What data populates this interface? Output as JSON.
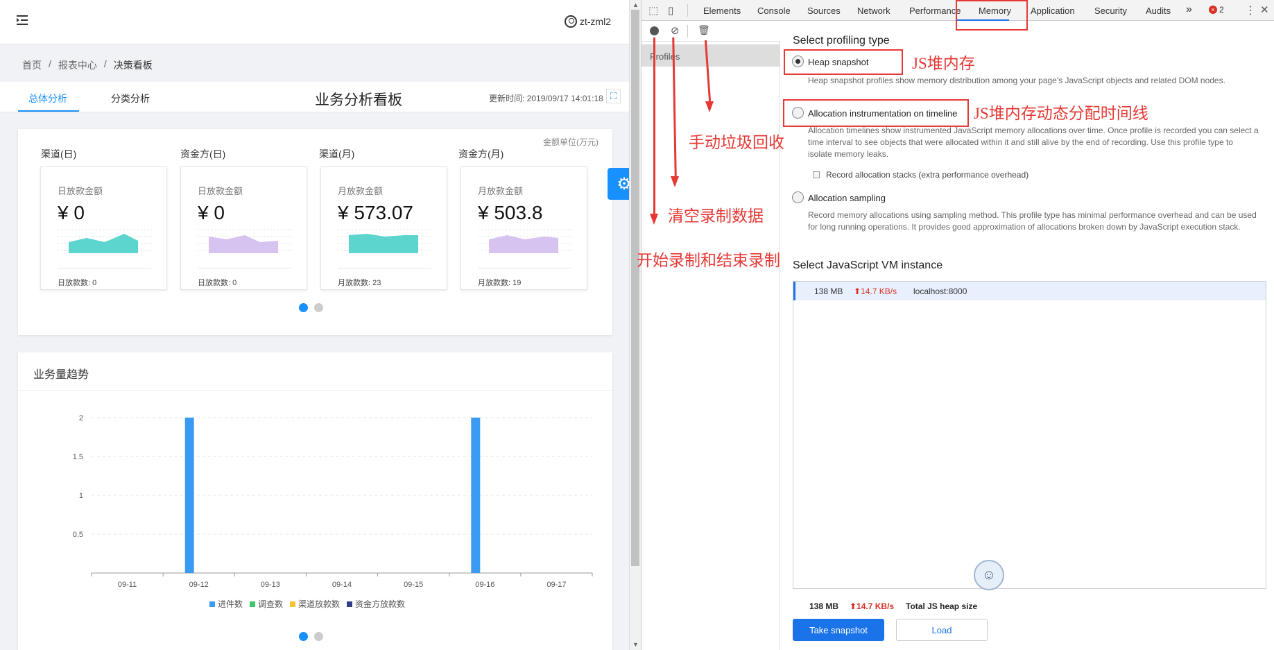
{
  "app": {
    "user": "zt-zml2",
    "breadcrumb": [
      "首页",
      "报表中心",
      "决策看板"
    ],
    "tabs": [
      "总体分析",
      "分类分析"
    ],
    "board_title": "业务分析看板",
    "updated": "更新时间: 2019/09/17 14:01:18",
    "unit_note": "金额单位(万元)",
    "kpis": [
      {
        "group": "渠道(日)",
        "label": "日放款金额",
        "value": "¥ 0",
        "count_label": "日放款数:",
        "count": "0",
        "color": "#5dd5cf"
      },
      {
        "group": "资金方(日)",
        "label": "日放款金额",
        "value": "¥ 0",
        "count_label": "日放款数:",
        "count": "0",
        "color": "#d7c3ef"
      },
      {
        "group": "渠道(月)",
        "label": "月放款金额",
        "value": "¥ 573.07",
        "count_label": "月放款数:",
        "count": "23",
        "color": "#5dd5cf"
      },
      {
        "group": "资金方(月)",
        "label": "月放款金额",
        "value": "¥ 503.8",
        "count_label": "月放款数:",
        "count": "19",
        "color": "#d7c3ef"
      }
    ],
    "trend_title": "业务量趋势",
    "legend": [
      {
        "name": "进件数",
        "color": "#3a9bf3"
      },
      {
        "name": "调查数",
        "color": "#3ec46b"
      },
      {
        "name": "渠道放款数",
        "color": "#f7c331"
      },
      {
        "name": "资金方放款数",
        "color": "#2d3f86"
      }
    ]
  },
  "chart_data": {
    "type": "bar",
    "categories": [
      "09-11",
      "09-12",
      "09-13",
      "09-14",
      "09-15",
      "09-16",
      "09-17"
    ],
    "series": [
      {
        "name": "进件数",
        "values": [
          0,
          2,
          0,
          0,
          0,
          2,
          0
        ]
      },
      {
        "name": "调查数",
        "values": [
          0,
          0,
          0,
          0,
          0,
          0,
          0
        ]
      },
      {
        "name": "渠道放款数",
        "values": [
          0,
          0,
          0,
          0,
          0,
          0,
          0
        ]
      },
      {
        "name": "资金方放款数",
        "values": [
          0,
          0,
          0,
          0,
          0,
          0,
          0
        ]
      }
    ],
    "yticks": [
      "2",
      "1.5",
      "1",
      "0.5"
    ],
    "ylim": [
      0,
      2
    ],
    "grid": true,
    "legend_position": "bottom"
  },
  "devtools": {
    "tabs": [
      "Elements",
      "Console",
      "Sources",
      "Network",
      "Performance",
      "Memory",
      "Application",
      "Security",
      "Audits"
    ],
    "overflow": "»",
    "error_count": "2",
    "side_item": "Profiles",
    "select_type_heading": "Select profiling type",
    "options": [
      {
        "label": "Heap snapshot",
        "desc": "Heap snapshot profiles show memory distribution among your page's JavaScript objects and related DOM nodes."
      },
      {
        "label": "Allocation instrumentation on timeline",
        "desc": "Allocation timelines show instrumented JavaScript memory allocations over time. Once profile is recorded you can select a time interval to see objects that were allocated within it and still alive by the end of recording. Use this profile type to isolate memory leaks."
      },
      {
        "label": "Allocation sampling",
        "desc": "Record memory allocations using sampling method. This profile type has minimal performance overhead and can be used for long running operations. It provides good approximation of allocations broken down by JavaScript execution stack."
      }
    ],
    "record_stacks": "Record allocation stacks (extra performance overhead)",
    "vm_heading": "Select JavaScript VM instance",
    "vm": {
      "size": "138 MB",
      "rate": "⬆14.7 KB/s",
      "target": "localhost:8000"
    },
    "footer": {
      "size": "138 MB",
      "rate": "⬆14.7 KB/s",
      "label": "Total JS heap size"
    },
    "take_snapshot": "Take snapshot",
    "load": "Load"
  },
  "annotations": {
    "heap": "JS堆内存",
    "timeline": "JS堆内存动态分配时间线",
    "gc": "手动垃圾回收",
    "clear": "清空录制数据",
    "record": "开始录制和结束录制"
  }
}
